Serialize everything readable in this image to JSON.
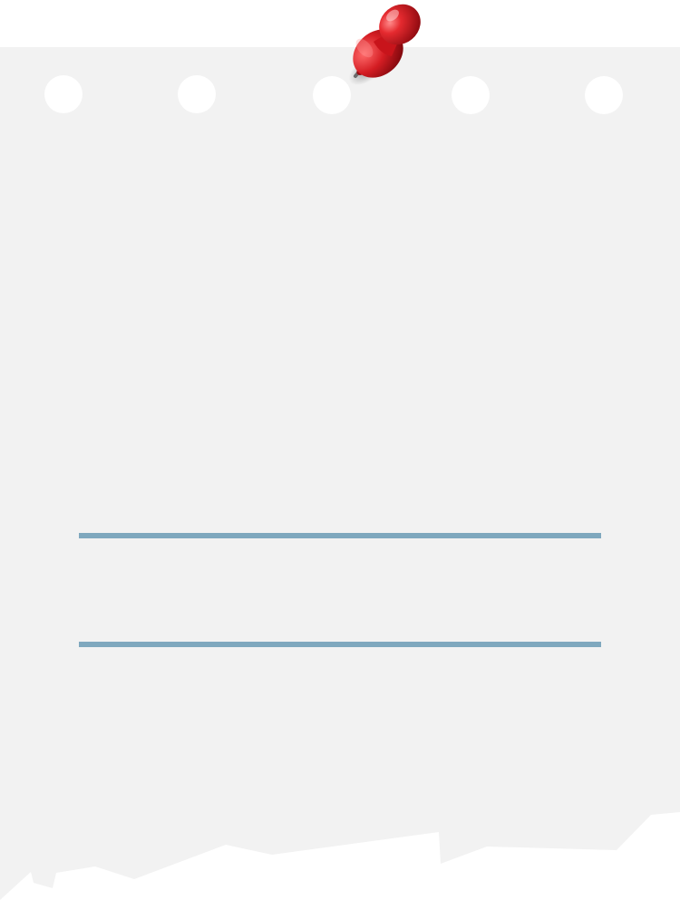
{
  "note": {
    "paper_color": "#f2f2f2",
    "background_color": "#ffffff",
    "rule_color": "#7fa8be",
    "punch_hole_color": "#ffffff",
    "punch_hole_count": 5,
    "rule_count": 2
  },
  "pushpin": {
    "icon": "pushpin-icon",
    "color": "#d81f26"
  }
}
